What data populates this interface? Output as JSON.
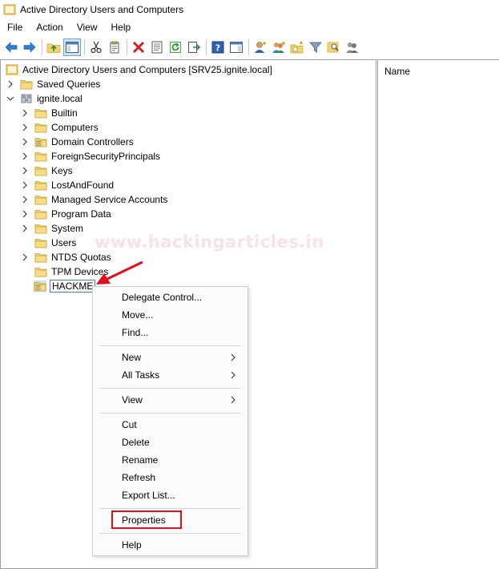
{
  "window": {
    "title": "Active Directory Users and Computers"
  },
  "menubar": {
    "items": [
      "File",
      "Action",
      "View",
      "Help"
    ]
  },
  "toolbar": {
    "icons": [
      "back-arrow-icon",
      "forward-arrow-icon",
      "up-folder-icon",
      "show-hide-console-tree-icon",
      "cut-icon",
      "copy-icon",
      "delete-icon",
      "properties-sheet-icon",
      "refresh-icon",
      "export-list-icon",
      "help-icon",
      "action-pane-icon",
      "new-user-icon",
      "new-group-icon",
      "new-ou-icon",
      "filter-icon",
      "find-icon",
      "add-to-group-icon"
    ]
  },
  "tree": {
    "root": "Active Directory Users and Computers [SRV25.ignite.local]",
    "saved_queries": "Saved Queries",
    "domain": "ignite.local",
    "children": [
      {
        "label": "Builtin",
        "expandable": true
      },
      {
        "label": "Computers",
        "expandable": true
      },
      {
        "label": "Domain Controllers",
        "expandable": true
      },
      {
        "label": "ForeignSecurityPrincipals",
        "expandable": true
      },
      {
        "label": "Keys",
        "expandable": true
      },
      {
        "label": "LostAndFound",
        "expandable": true
      },
      {
        "label": "Managed Service Accounts",
        "expandable": true
      },
      {
        "label": "Program Data",
        "expandable": true
      },
      {
        "label": "System",
        "expandable": true
      },
      {
        "label": "Users",
        "expandable": false
      },
      {
        "label": "NTDS Quotas",
        "expandable": true
      },
      {
        "label": "TPM Devices",
        "expandable": false
      },
      {
        "label": "HACKME",
        "expandable": false,
        "selected": true
      }
    ]
  },
  "right_pane": {
    "column_header": "Name"
  },
  "watermark": "www.hackingarticles.in",
  "context_menu": {
    "delegate_control": "Delegate Control...",
    "move": "Move...",
    "find": "Find...",
    "new": "New",
    "all_tasks": "All Tasks",
    "view": "View",
    "cut": "Cut",
    "delete": "Delete",
    "rename": "Rename",
    "refresh": "Refresh",
    "export_list": "Export List...",
    "properties": "Properties",
    "help": "Help"
  },
  "colors": {
    "folder": "#e8c25a",
    "highlight_box": "#e0101b",
    "annotation_arrow": "#e0101b",
    "selection_border": "#4a7fbf"
  }
}
